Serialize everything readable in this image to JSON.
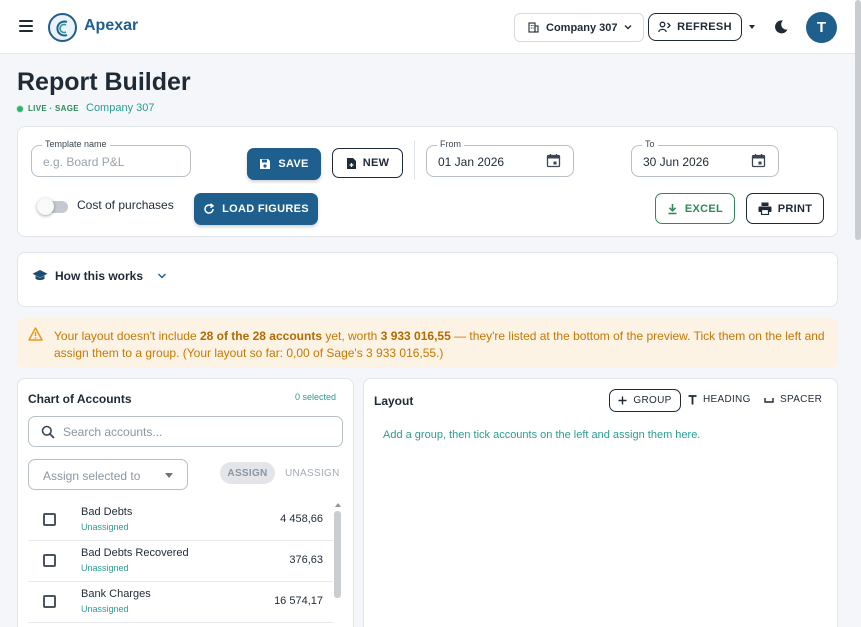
{
  "header": {
    "brand": "Apexar",
    "company_select": "Company 307",
    "refresh_label": "REFRESH",
    "avatar_initial": "T"
  },
  "page": {
    "title": "Report Builder",
    "live_label": "LIVE · SAGE",
    "company_link": "Company 307"
  },
  "form": {
    "template_label": "Template name",
    "template_placeholder": "e.g. Board P&L",
    "save_label": "SAVE",
    "new_label": "NEW",
    "from_label": "From",
    "from_value": "01 Jan 2026",
    "to_label": "To",
    "to_value": "30 Jun 2026",
    "toggle_label": "Cost of purchases",
    "toggle_on": false,
    "load_label": "LOAD FIGURES",
    "excel_label": "EXCEL",
    "print_label": "PRINT"
  },
  "how": {
    "title": "How this works"
  },
  "warning": {
    "text_1": "Your layout doesn't include ",
    "bold_1": "28 of the 28 accounts",
    "text_2": " yet, worth ",
    "bold_2": "3 933 016,55",
    "text_3": " — they're listed at the bottom of the preview. Tick them on the left and assign them to a group. (Your layout so far: 0,00 of Sage's 3 933 016,55.)"
  },
  "accounts_panel": {
    "title": "Chart of Accounts",
    "selected_count": "0 selected",
    "search_placeholder": "Search accounts...",
    "assign_placeholder": "Assign selected to",
    "assign_label": "ASSIGN",
    "unassign_label": "UNASSIGN",
    "rows": [
      {
        "name": "Bad Debts",
        "status": "Unassigned",
        "amount": "4 458,66"
      },
      {
        "name": "Bad Debts Recovered",
        "status": "Unassigned",
        "amount": "376,63"
      },
      {
        "name": "Bank Charges",
        "status": "Unassigned",
        "amount": "16 574,17"
      }
    ]
  },
  "layout_panel": {
    "title": "Layout",
    "group_label": "GROUP",
    "heading_label": "HEADING",
    "spacer_label": "SPACER",
    "hint": "Add a group, then tick accounts on the left and assign them here."
  },
  "colors": {
    "primary": "#1e5f8e",
    "accent_teal": "#2a9d8f",
    "warning_text": "#c77700",
    "warning_bg": "#fdf3e5",
    "excel_green": "#2e8b57",
    "live_green": "#2fb36a"
  }
}
